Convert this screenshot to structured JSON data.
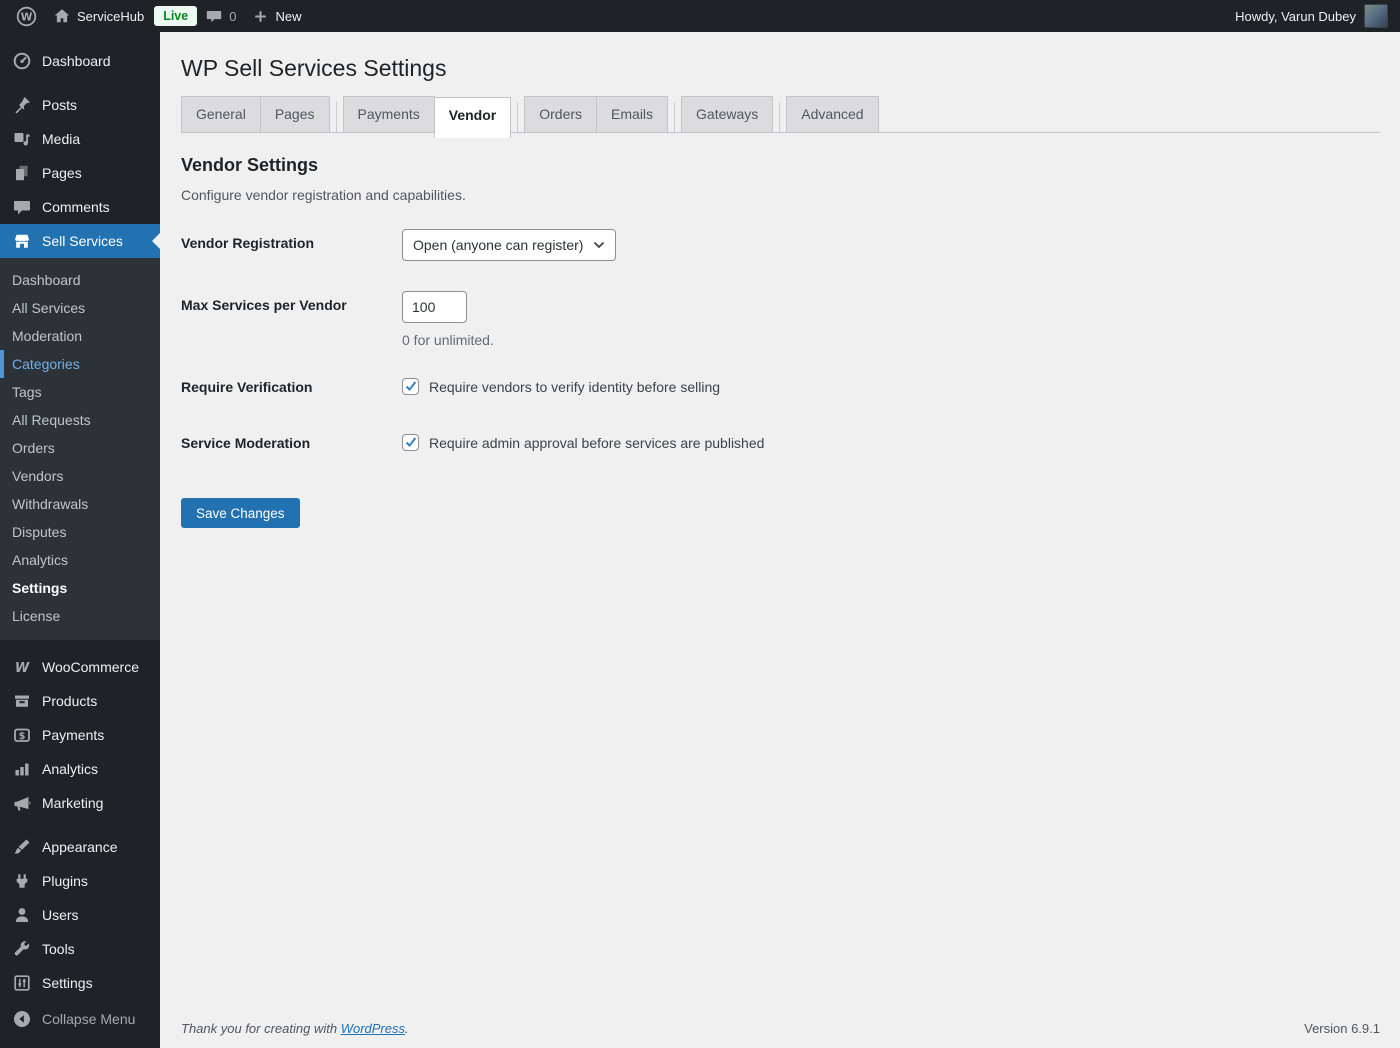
{
  "admin_bar": {
    "site_name": "ServiceHub",
    "live_badge": "Live",
    "comment_count": "0",
    "new_label": "New",
    "howdy": "Howdy, Varun Dubey"
  },
  "sidebar": {
    "main": [
      {
        "label": "Dashboard",
        "icon": "dashboard-icon"
      },
      {
        "label": "Posts",
        "icon": "pushpin-icon"
      },
      {
        "label": "Media",
        "icon": "media-icon"
      },
      {
        "label": "Pages",
        "icon": "pages-icon"
      },
      {
        "label": "Comments",
        "icon": "comments-icon"
      },
      {
        "label": "Sell Services",
        "icon": "storefront-icon",
        "active": true
      }
    ],
    "submenu": [
      {
        "label": "Dashboard"
      },
      {
        "label": "All Services"
      },
      {
        "label": "Moderation"
      },
      {
        "label": "Categories",
        "highlight": true
      },
      {
        "label": "Tags"
      },
      {
        "label": "All Requests"
      },
      {
        "label": "Orders"
      },
      {
        "label": "Vendors"
      },
      {
        "label": "Withdrawals"
      },
      {
        "label": "Disputes"
      },
      {
        "label": "Analytics"
      },
      {
        "label": "Settings",
        "current": true
      },
      {
        "label": "License"
      }
    ],
    "commerce_group": [
      {
        "label": "WooCommerce",
        "icon": "woocommerce-icon"
      },
      {
        "label": "Products",
        "icon": "box-icon"
      },
      {
        "label": "Payments",
        "icon": "dollar-card-icon"
      },
      {
        "label": "Analytics",
        "icon": "bar-chart-icon"
      },
      {
        "label": "Marketing",
        "icon": "megaphone-icon"
      }
    ],
    "admin_group": [
      {
        "label": "Appearance",
        "icon": "brush-icon"
      },
      {
        "label": "Plugins",
        "icon": "plugin-icon"
      },
      {
        "label": "Users",
        "icon": "user-icon"
      },
      {
        "label": "Tools",
        "icon": "wrench-icon"
      },
      {
        "label": "Settings",
        "icon": "sliders-icon"
      }
    ],
    "collapse_label": "Collapse Menu"
  },
  "page": {
    "title": "WP Sell Services Settings",
    "tabs": [
      {
        "label": "General"
      },
      {
        "label": "Pages"
      },
      {
        "label": "Payments"
      },
      {
        "label": "Vendor",
        "active": true
      },
      {
        "label": "Orders"
      },
      {
        "label": "Emails"
      },
      {
        "label": "Gateways"
      },
      {
        "label": "Advanced"
      }
    ],
    "section_heading": "Vendor Settings",
    "section_description": "Configure vendor registration and capabilities.",
    "form": {
      "rows": [
        {
          "label": "Vendor Registration",
          "control": "select",
          "value": "Open (anyone can register)"
        },
        {
          "label": "Max Services per Vendor",
          "control": "input",
          "value": "100",
          "help": "0 for unlimited."
        },
        {
          "label": "Require Verification",
          "control": "checkbox",
          "checked": true,
          "text": "Require vendors to verify identity before selling"
        },
        {
          "label": "Service Moderation",
          "control": "checkbox",
          "checked": true,
          "text": "Require admin approval before services are published"
        }
      ],
      "save_label": "Save Changes"
    }
  },
  "footer": {
    "thanks_prefix": "Thank you for creating with ",
    "link_text": "WordPress",
    "suffix": ".",
    "version": "Version 6.9.1"
  },
  "colors": {
    "accent_blue": "#2271b1",
    "menu_dark": "#1d2327",
    "submenu_dark": "#2c3338",
    "content_bg": "#f0f0f1",
    "tab_inactive_bg": "#dcdcde",
    "border_gray": "#c3c4c7",
    "input_border": "#8c8f94",
    "submenu_highlight": "#72aee6",
    "live_green": "#008a20",
    "live_bg": "#edfaef",
    "check_blue": "#3582c4"
  }
}
